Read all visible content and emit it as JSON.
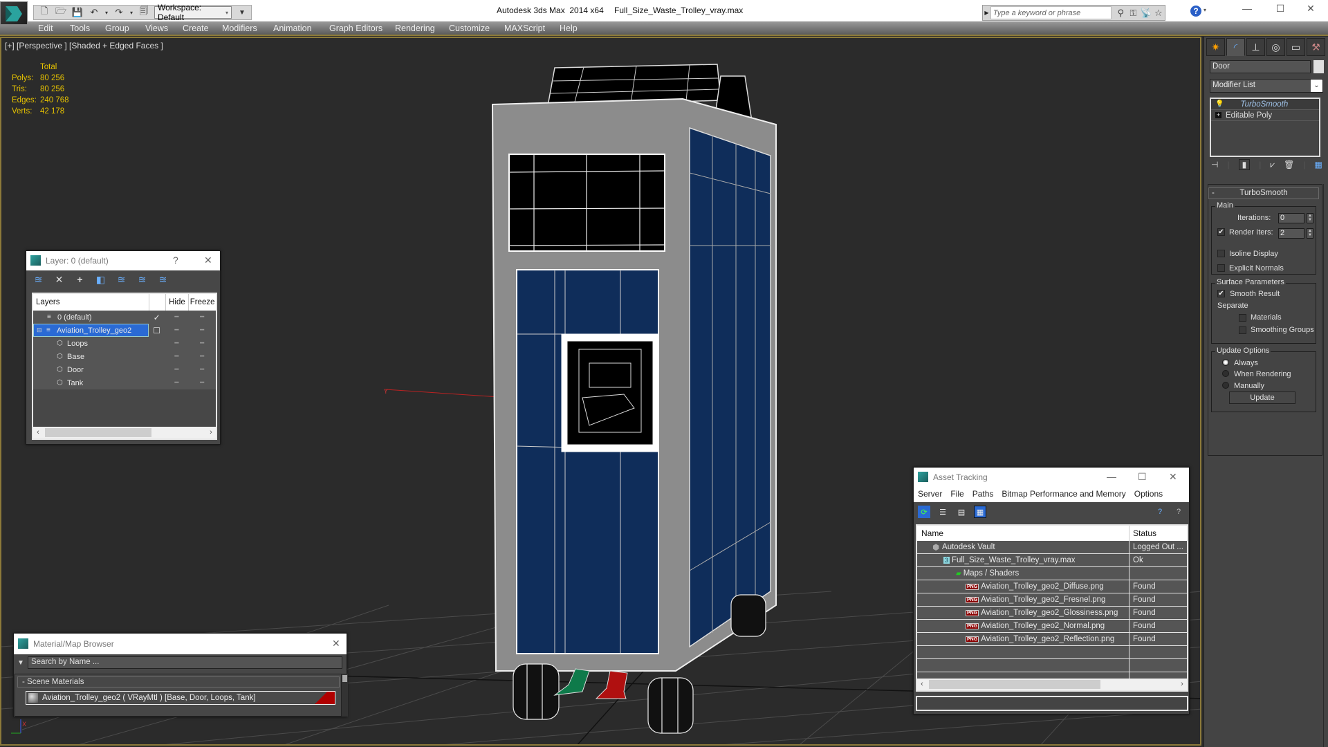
{
  "titlebar": {
    "app_title": "Autodesk 3ds Max  2014 x64",
    "file_name": "Full_Size_Waste_Trolley_vray.max",
    "workspace": "Workspace: Default",
    "search_placeholder": "Type a keyword or phrase",
    "window_controls": [
      "minimize",
      "maximize",
      "close"
    ]
  },
  "menubar": {
    "items": [
      "Edit",
      "Tools",
      "Group",
      "Views",
      "Create",
      "Modifiers",
      "Animation",
      "Graph Editors",
      "Rendering",
      "Customize",
      "MAXScript",
      "Help"
    ]
  },
  "viewport": {
    "label": "[+] [Perspective ] [Shaded + Edged Faces ]",
    "stats": {
      "header": "Total",
      "rows": [
        {
          "label": "Polys:",
          "value": "80 256"
        },
        {
          "label": "Tris:",
          "value": "80 256"
        },
        {
          "label": "Edges:",
          "value": "240 768"
        },
        {
          "label": "Verts:",
          "value": "42 178"
        }
      ]
    },
    "colors": {
      "panel_blue": "#0f2d5a",
      "frame_gray": "#8a8a8a",
      "pedal_green": "#0e7a4a",
      "pedal_red": "#b01010",
      "stats_yellow": "#e6c200"
    }
  },
  "command_panel": {
    "object_name": "Door",
    "modifier_list": "Modifier List",
    "stack": [
      "TurboSmooth",
      "Editable Poly"
    ],
    "rollout_title": "TurboSmooth",
    "main_group": "Main",
    "iterations_label": "Iterations:",
    "iterations_value": "0",
    "render_iters_label": "Render Iters:",
    "render_iters_value": "2",
    "render_iters_checked": true,
    "isoline_label": "Isoline Display",
    "explicit_normals_label": "Explicit Normals",
    "surface_group": "Surface Parameters",
    "smooth_result_label": "Smooth Result",
    "separate_label": "Separate",
    "materials_label": "Materials",
    "smoothing_groups_label": "Smoothing Groups",
    "update_group": "Update Options",
    "update_options": [
      "Always",
      "When Rendering",
      "Manually"
    ],
    "update_selected": "Always",
    "update_button": "Update"
  },
  "layer_window": {
    "title": "Layer: 0 (default)",
    "help": "?",
    "columns": [
      "Layers",
      "",
      "Hide",
      "Freeze"
    ],
    "rows": [
      {
        "name": "0 (default)",
        "current": "✓",
        "level": 1,
        "type": "layer"
      },
      {
        "name": "Aviation_Trolley_geo2",
        "current": "☐",
        "level": 0,
        "type": "layer",
        "selected": true
      },
      {
        "name": "Loops",
        "level": 2,
        "type": "object"
      },
      {
        "name": "Base",
        "level": 2,
        "type": "object"
      },
      {
        "name": "Door",
        "level": 2,
        "type": "object"
      },
      {
        "name": "Tank",
        "level": 2,
        "type": "object"
      }
    ]
  },
  "asset_tracking": {
    "title": "Asset Tracking",
    "menu": [
      "Server",
      "File",
      "Paths",
      "Bitmap Performance and Memory",
      "Options"
    ],
    "columns": [
      "Name",
      "Status"
    ],
    "rows": [
      {
        "name": "Autodesk Vault",
        "status": "Logged Out ...",
        "level": 1,
        "icon": "vault"
      },
      {
        "name": "Full_Size_Waste_Trolley_vray.max",
        "status": "Ok",
        "level": 2,
        "icon": "max-file"
      },
      {
        "name": "Maps / Shaders",
        "status": "",
        "level": 3,
        "icon": "maps"
      },
      {
        "name": "Aviation_Trolley_geo2_Diffuse.png",
        "status": "Found",
        "level": 4,
        "icon": "png"
      },
      {
        "name": "Aviation_Trolley_geo2_Fresnel.png",
        "status": "Found",
        "level": 4,
        "icon": "png"
      },
      {
        "name": "Aviation_Trolley_geo2_Glossiness.png",
        "status": "Found",
        "level": 4,
        "icon": "png"
      },
      {
        "name": "Aviation_Trolley_geo2_Normal.png",
        "status": "Found",
        "level": 4,
        "icon": "png"
      },
      {
        "name": "Aviation_Trolley_geo2_Reflection.png",
        "status": "Found",
        "level": 4,
        "icon": "png"
      }
    ]
  },
  "material_browser": {
    "title": "Material/Map Browser",
    "search_placeholder": "Search by Name ...",
    "group": "- Scene Materials",
    "item": "Aviation_Trolley_geo2  ( VRayMtl ) [Base, Door, Loops, Tank]"
  }
}
